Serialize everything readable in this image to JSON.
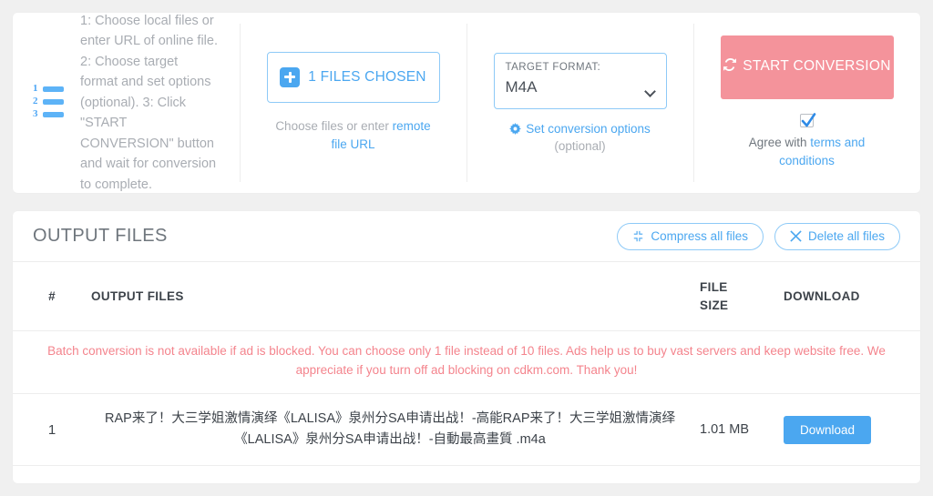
{
  "instructions": {
    "icon": "numbered-list-icon",
    "text": "1: Choose local files or enter URL of online file. 2: Choose target format and set options (optional). 3: Click \"START CONVERSION\" button and wait for conversion to complete."
  },
  "file_chooser": {
    "icon": "plus-square-icon",
    "button_label": "1 FILES CHOSEN",
    "note_prefix": "Choose files or enter ",
    "note_link": "remote file URL"
  },
  "target_format": {
    "label": "TARGET FORMAT:",
    "value": "M4A",
    "chevron_icon": "chevron-down-icon",
    "options_icon": "gear-icon",
    "options_link": "Set conversion options",
    "optional_note": "(optional)"
  },
  "start": {
    "icon": "sync-icon",
    "button_label": "START CONVERSION",
    "checkbox_checked": true,
    "agree_prefix": "Agree with ",
    "agree_link": "terms and conditions"
  },
  "output": {
    "title": "OUTPUT FILES",
    "compress_icon": "compress-icon",
    "compress_label": "Compress all files",
    "delete_icon": "close-x-icon",
    "delete_label": "Delete all files",
    "columns": {
      "num": "#",
      "name": "OUTPUT FILES",
      "size_line1": "FILE",
      "size_line2": "SIZE",
      "download": "DOWNLOAD"
    },
    "warning": "Batch conversion is not available if ad is blocked. You can choose only 1 file instead of 10 files. Ads help us to buy vast servers and keep website free. We appreciate if you turn off ad blocking on cdkm.com. Thank you!",
    "rows": [
      {
        "num": "1",
        "name": "RAP来了！大三学姐激情演绎《LALISA》泉州分SA申请出战！-高能RAP来了！大三学姐激情演绎《LALISA》泉州分SA申请出战！-自動最高畫質 .m4a",
        "size": "1.01 MB",
        "download_label": "Download"
      }
    ]
  },
  "colors": {
    "accent_blue": "#4ba7f0",
    "start_pink": "#f4939b",
    "warning_red": "#f4848d",
    "page_bg": "#f0f0f0",
    "panel_bg": "#ffffff",
    "muted_text": "#a9adb3"
  }
}
